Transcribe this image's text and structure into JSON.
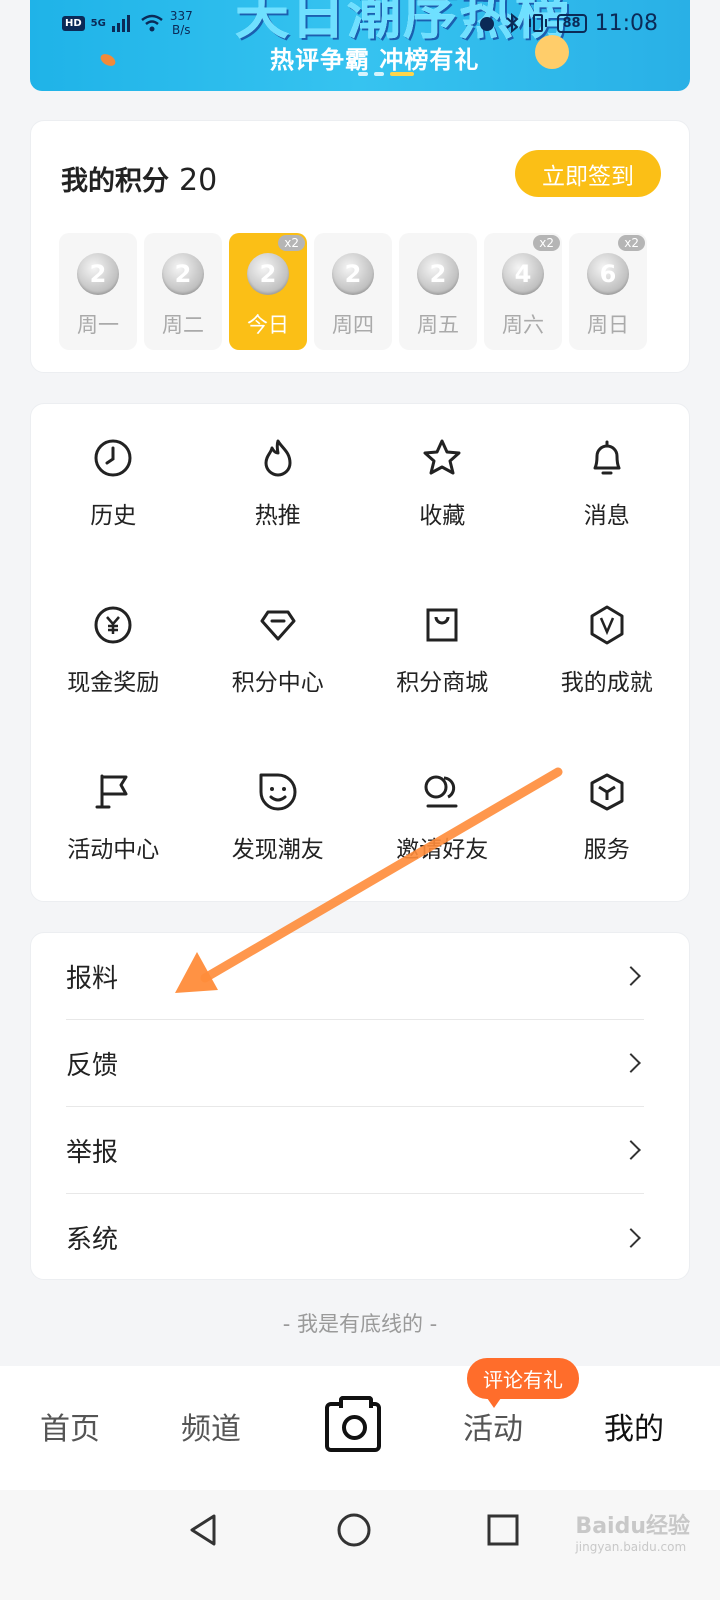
{
  "status_bar": {
    "hd": "HD",
    "network": "5G",
    "speed": "337",
    "speed_unit": "B/s",
    "battery": "88",
    "time": "11:08"
  },
  "banner": {
    "headline": "天日潮序热榜",
    "subtitle": "热评争霸  冲榜有礼"
  },
  "points": {
    "title": "我的积分",
    "value": "20",
    "signin_label": "立即签到",
    "days": [
      {
        "coin": "2",
        "label": "周一",
        "x2": ""
      },
      {
        "coin": "2",
        "label": "周二",
        "x2": ""
      },
      {
        "coin": "2",
        "label": "今日",
        "x2": "x2",
        "today": true
      },
      {
        "coin": "2",
        "label": "周四",
        "x2": ""
      },
      {
        "coin": "2",
        "label": "周五",
        "x2": ""
      },
      {
        "coin": "4",
        "label": "周六",
        "x2": "x2"
      },
      {
        "coin": "6",
        "label": "周日",
        "x2": "x2"
      }
    ]
  },
  "grid": [
    {
      "label": "历史",
      "icon": "clock-icon"
    },
    {
      "label": "热推",
      "icon": "flame-icon"
    },
    {
      "label": "收藏",
      "icon": "star-icon"
    },
    {
      "label": "消息",
      "icon": "bell-icon"
    },
    {
      "label": "现金奖励",
      "icon": "yuan-icon"
    },
    {
      "label": "积分中心",
      "icon": "diamond-icon"
    },
    {
      "label": "积分商城",
      "icon": "shopping-bag-icon"
    },
    {
      "label": "我的成就",
      "icon": "v-badge-icon"
    },
    {
      "label": "活动中心",
      "icon": "flag-icon"
    },
    {
      "label": "发现潮友",
      "icon": "smile-icon"
    },
    {
      "label": "邀请好友",
      "icon": "friends-icon"
    },
    {
      "label": "服务",
      "icon": "box-icon"
    }
  ],
  "list": [
    {
      "label": "报料"
    },
    {
      "label": "反馈"
    },
    {
      "label": "举报"
    },
    {
      "label": "系统"
    }
  ],
  "footer": "- 我是有底线的 -",
  "tabbar": {
    "home": "首页",
    "channel": "频道",
    "activity": "活动",
    "mine": "我的",
    "badge": "评论有礼"
  },
  "watermark": {
    "brand": "Baidu经验",
    "url": "jingyan.baidu.com"
  },
  "colors": {
    "accent": "#fbbf16",
    "badge": "#ff6d2b",
    "arrow": "#ff8c3a"
  }
}
